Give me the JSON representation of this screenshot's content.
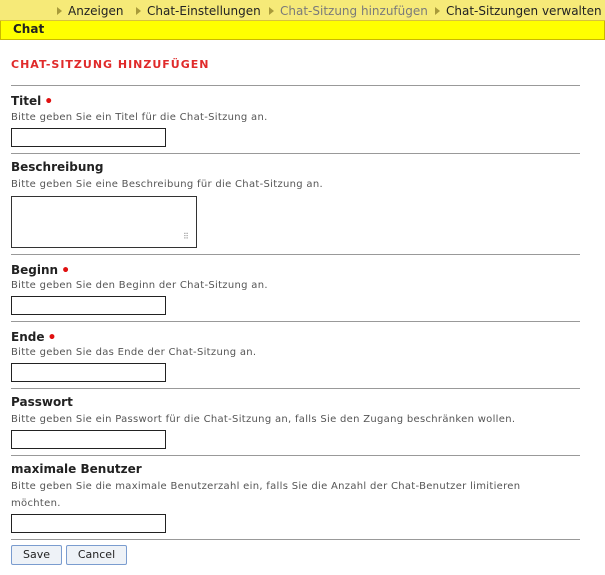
{
  "nav": {
    "items": [
      {
        "label": "Anzeigen"
      },
      {
        "label": "Chat-Einstellungen"
      },
      {
        "label": "Chat-Sitzung hinzufügen"
      },
      {
        "label": "Chat-Sitzungen verwalten"
      }
    ],
    "active_index": 2,
    "section": "Chat"
  },
  "form": {
    "title": "CHAT-SITZUNG HINZUFÜGEN",
    "required_marker": "•",
    "fields": [
      {
        "label": "Titel",
        "required": true,
        "hint": "Bitte geben Sie ein Titel für die Chat-Sitzung an.",
        "value": ""
      },
      {
        "label": "Beschreibung",
        "required": false,
        "hint": "Bitte geben Sie eine Beschreibung für die Chat-Sitzung an.",
        "value": ""
      },
      {
        "label": "Beginn",
        "required": true,
        "hint": "Bitte geben Sie den Beginn der Chat-Sitzung an.",
        "value": ""
      },
      {
        "label": "Ende",
        "required": true,
        "hint": "Bitte geben Sie das Ende der Chat-Sitzung an.",
        "value": ""
      },
      {
        "label": "Passwort",
        "required": false,
        "hint": "Bitte geben Sie ein Passwort für die Chat-Sitzung an, falls Sie den Zugang beschränken wollen.",
        "value": ""
      },
      {
        "label": "maximale Benutzer",
        "required": false,
        "hint": "Bitte geben Sie die maximale Benutzerzahl ein, falls Sie die Anzahl der Chat-Benutzer limitieren möchten.",
        "value": ""
      }
    ],
    "save_label": "Save",
    "cancel_label": "Cancel"
  },
  "colors": {
    "nav_bg": "#f6ea78",
    "section_bg": "#ffff00",
    "title_red": "#e02a2a",
    "required_red": "#e01010"
  }
}
